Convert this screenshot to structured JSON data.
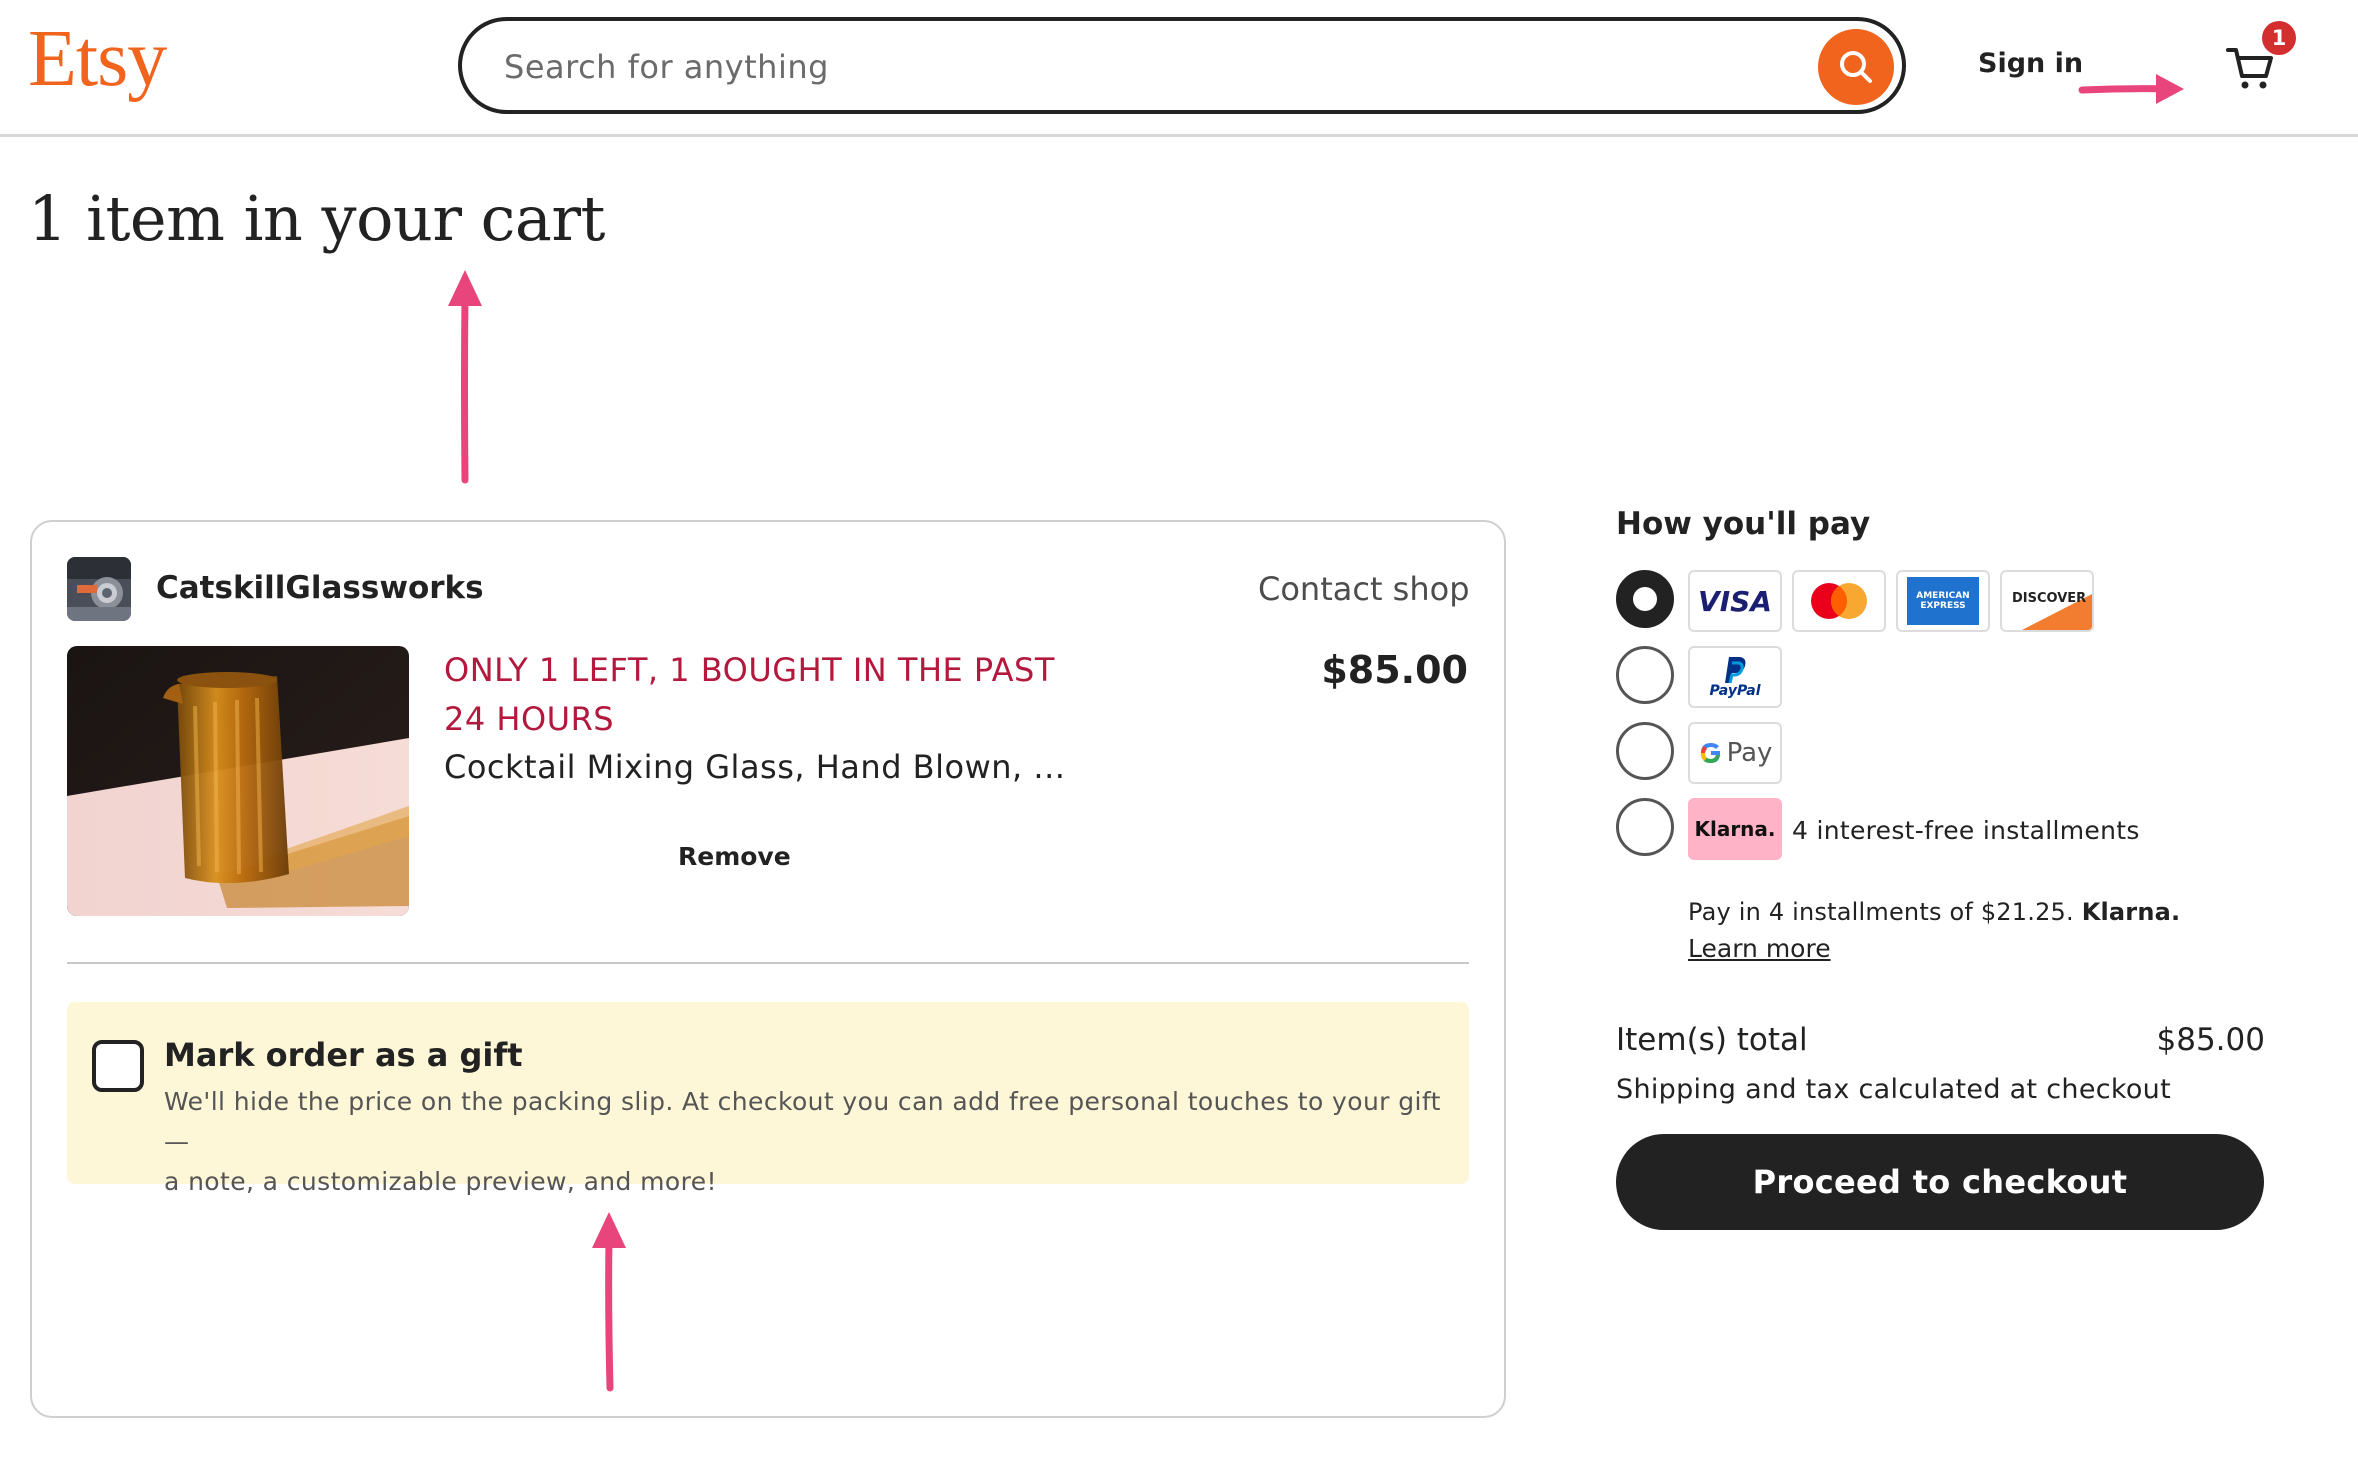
{
  "header": {
    "logo": "Etsy",
    "search_placeholder": "Search for anything",
    "sign_in": "Sign in",
    "cart_count": "1",
    "brand_color": "#F1641E"
  },
  "page_title": "1 item in your cart",
  "cart": {
    "shop_name": "CatskillGlassworks",
    "contact_shop": "Contact shop",
    "scarcity_line1": "ONLY 1 LEFT, 1 BOUGHT IN THE PAST",
    "scarcity_line2": "24 HOURS",
    "item_title": "Cocktail Mixing Glass, Hand Blown, ...",
    "price": "$85.00",
    "remove": "Remove",
    "gift": {
      "title": "Mark order as a gift",
      "description_line1": "We'll hide the price on the packing slip. At checkout you can add free personal touches to your gift—",
      "description_line2": "a note, a customizable preview, and more!",
      "checked": false
    }
  },
  "payment": {
    "heading": "How you'll pay",
    "options": [
      {
        "name": "cards",
        "selected": true,
        "cards": [
          "VISA",
          "Mastercard",
          "AMERICAN EXPRESS",
          "DISCOVER"
        ]
      },
      {
        "name": "paypal",
        "selected": false,
        "label": "PayPal"
      },
      {
        "name": "google-pay",
        "selected": false,
        "label": "Pay"
      },
      {
        "name": "klarna",
        "selected": false,
        "label": "Klarna.",
        "text": "4 interest-free installments"
      }
    ],
    "installments_text": "Pay in 4 installments of $21.25.",
    "installments_brand": "Klarna.",
    "learn_more": "Learn more",
    "total_label": "Item(s) total",
    "total_value": "$85.00",
    "shipping_note": "Shipping and tax calculated at checkout",
    "checkout_button": "Proceed to checkout"
  },
  "annotation_color": "#E8457D"
}
